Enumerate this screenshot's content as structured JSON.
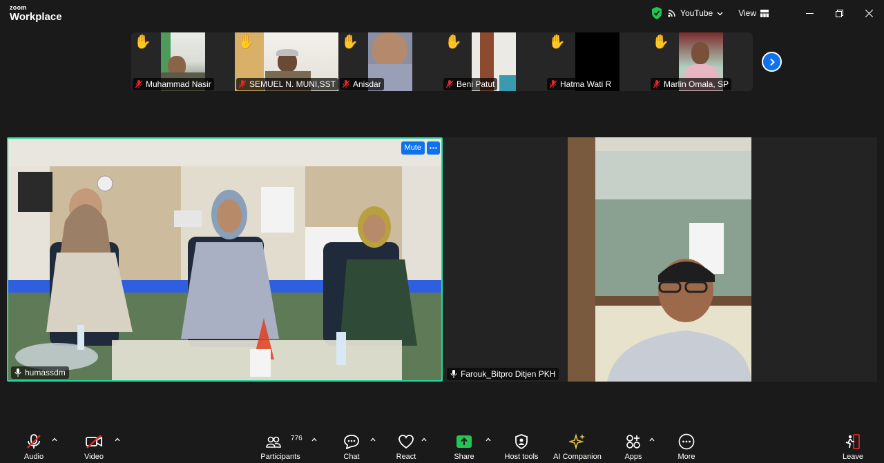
{
  "app": {
    "logo_top": "zoom",
    "logo_bottom": "Workplace"
  },
  "titlebar": {
    "stream_label": "YouTube",
    "view_label": "View",
    "colors": {
      "shield": "#23c552",
      "accent": "#0e72ed"
    }
  },
  "thumbnails": [
    {
      "name": "Muhammad Nasir",
      "hand": "✋"
    },
    {
      "name": "SEMUEL N. MUNI,SST",
      "hand": "✋"
    },
    {
      "name": "Anisdar",
      "hand": "✋"
    },
    {
      "name": "Beni Patut",
      "hand": "✋"
    },
    {
      "name": "Hatma Wati R",
      "hand": "✋"
    },
    {
      "name": "Marlin Omala, SP",
      "hand": "✋"
    }
  ],
  "videos": {
    "left": {
      "name": "humassdm",
      "mute_label": "Mute"
    },
    "right": {
      "name": "Farouk_Bitpro Ditjen PKH"
    }
  },
  "toolbar": {
    "audio": "Audio",
    "video": "Video",
    "participants": "Participants",
    "participants_count": "776",
    "chat": "Chat",
    "react": "React",
    "share": "Share",
    "host_tools": "Host tools",
    "ai_companion": "AI Companion",
    "apps": "Apps",
    "more": "More",
    "leave": "Leave",
    "colors": {
      "muted": "#e02828",
      "share": "#23c552",
      "leave": "#e02828"
    }
  }
}
